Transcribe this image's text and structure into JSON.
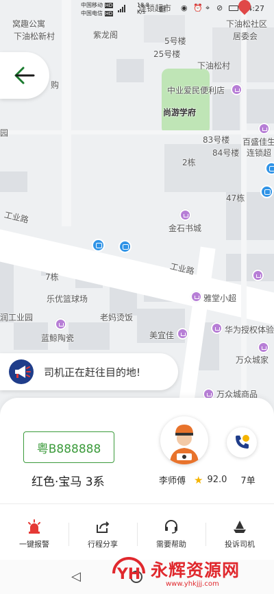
{
  "status_bar": {
    "carrier1": "中国移动",
    "carrier2": "中国电信",
    "net_badge": "HD",
    "speed": "18.8",
    "speed_unit": "K/s",
    "time": "14:27"
  },
  "map": {
    "labels": {
      "wodi": "窝趣公寓",
      "xiayousongxincun": "下油松新村",
      "lianjinchao_top": "连锁超市",
      "zilongge": "紫龙阁",
      "xiayousongshequ": "下油松社区",
      "juweihui": "居委会",
      "b5": "5号楼",
      "b25": "25号楼",
      "xiayousongcun": "下油松村",
      "gou": "购",
      "zhongye": "中业爱民便利店",
      "shangyouxuefu": "尚游学府",
      "yuan": "园",
      "b83": "83号楼",
      "b84": "84号楼",
      "baishengjia": "百盛佳生",
      "lianjinchao": "连锁超",
      "b2": "2栋",
      "b47": "47栋",
      "gongyelu1": "工业路",
      "jinshi": "金石书城",
      "gongyelu2": "工业路",
      "b7": "7栋",
      "yataang": "雅堂小超",
      "leyou": "乐优篮球场",
      "gongyeyuan": "润工业园",
      "laomama": "老妈烫饭",
      "meiyijia": "美宜佳",
      "huawei": "华为授权体验",
      "lanjing": "蓝鲸陶瓷",
      "wanzhong": "万众城家",
      "wanzhongshangpin": "万众城商品"
    }
  },
  "back_button": {
    "icon": "arrow-left-icon"
  },
  "toast": {
    "icon": "megaphone-icon",
    "text": "司机正在赶往目的地!"
  },
  "trip": {
    "plate": "粤B888888",
    "car": "红色·宝马 3系"
  },
  "driver": {
    "name": "李师傅",
    "rating": "92.0",
    "orders": "7单"
  },
  "actions": [
    {
      "label": "一键报警",
      "icon": "alarm-icon"
    },
    {
      "label": "行程分享",
      "icon": "share-icon"
    },
    {
      "label": "需要帮助",
      "icon": "headset-icon"
    },
    {
      "label": "投诉司机",
      "icon": "complaint-icon"
    }
  ],
  "watermark": {
    "logo": "YH",
    "text": "永辉资源网",
    "url": "www.yhkjjj.com"
  },
  "colors": {
    "plate": "#3a9a3a",
    "star": "#f5b400",
    "alarm": "#e53935",
    "accent": "#1f3d8a"
  }
}
